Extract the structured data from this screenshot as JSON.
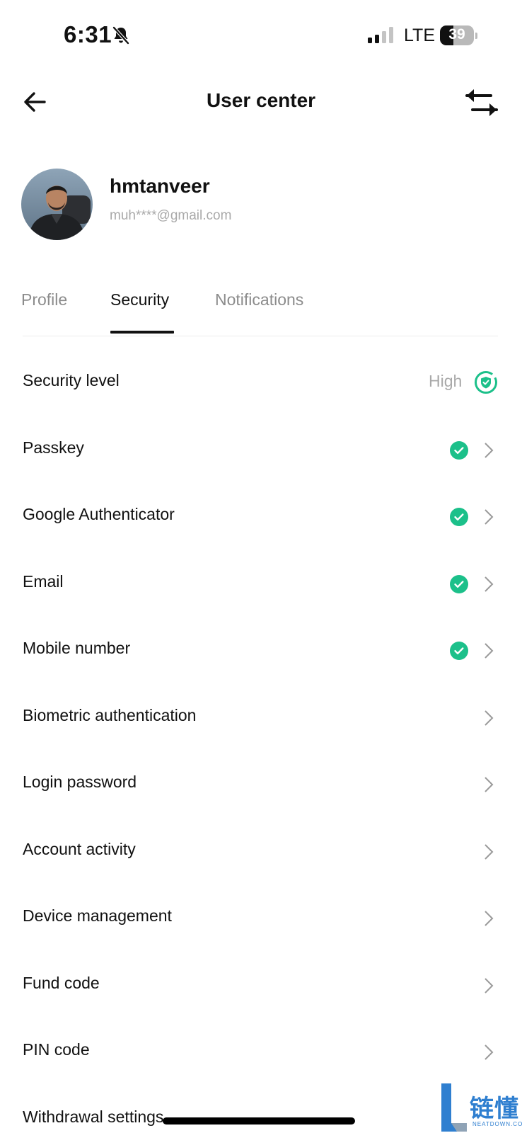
{
  "status_bar": {
    "time": "6:31",
    "network": "LTE",
    "battery": "39",
    "battery_level": 0.39,
    "icons": [
      "bell-off-icon",
      "signal-icon",
      "battery-icon"
    ]
  },
  "header": {
    "title": "User center",
    "back_icon": "arrow-left-icon",
    "switch_icon": "swap-arrows-icon"
  },
  "profile": {
    "username": "hmtanveer",
    "email": "muh****@gmail.com"
  },
  "tabs": [
    {
      "label": "Profile",
      "active": false
    },
    {
      "label": "Security",
      "active": true
    },
    {
      "label": "Notifications",
      "active": false
    }
  ],
  "security": {
    "level_label": "Security level",
    "level_value": "High",
    "items": [
      {
        "label": "Passkey",
        "verified": true
      },
      {
        "label": "Google Authenticator",
        "verified": true
      },
      {
        "label": "Email",
        "verified": true
      },
      {
        "label": "Mobile number",
        "verified": true
      },
      {
        "label": "Biometric authentication",
        "verified": false
      },
      {
        "label": "Login password",
        "verified": false
      },
      {
        "label": "Account activity",
        "verified": false
      },
      {
        "label": "Device management",
        "verified": false
      },
      {
        "label": "Fund code",
        "verified": false
      },
      {
        "label": "PIN code",
        "verified": false
      },
      {
        "label": "Withdrawal settings",
        "verified": false
      }
    ]
  },
  "colors": {
    "accent": "#1cc08a",
    "text_primary": "#111111",
    "text_secondary": "#8c8c8c"
  },
  "watermark": {
    "text_cn": "链懂",
    "text_en": "NEATDOWN.COM"
  }
}
